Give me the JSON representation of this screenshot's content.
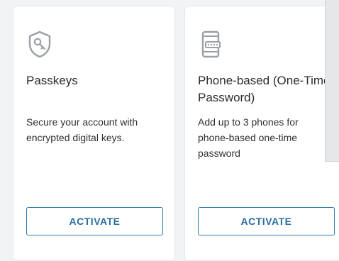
{
  "cards": [
    {
      "icon": "shield-key-icon",
      "title": "Passkeys",
      "description": "Secure your account with encrypted digital keys.",
      "button_label": "ACTIVATE"
    },
    {
      "icon": "phone-password-icon",
      "title": "Phone-based (One-Time Password)",
      "description": "Add up to 3 phones for phone-based one-time password",
      "button_label": "ACTIVATE"
    }
  ],
  "colors": {
    "accent": "#2f78a8",
    "icon_gray": "#9aa0a6",
    "background": "#f2f3f4",
    "card": "#ffffff"
  }
}
